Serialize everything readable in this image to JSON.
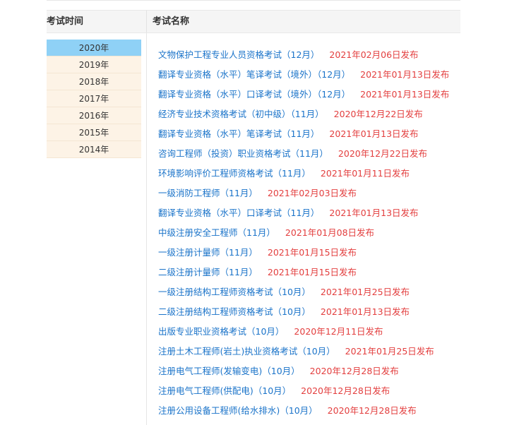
{
  "header": {
    "time_label": "考试时间",
    "name_label": "考试名称"
  },
  "years": [
    "2020年",
    "2019年",
    "2018年",
    "2017年",
    "2016年",
    "2015年",
    "2014年"
  ],
  "active_year_index": 0,
  "exams": [
    {
      "name": "文物保护工程专业人员资格考试（12月）",
      "date": "2021年02月06日发布"
    },
    {
      "name": "翻译专业资格（水平）笔译考试（境外）（12月）",
      "date": "2021年01月13日发布"
    },
    {
      "name": "翻译专业资格（水平）口译考试（境外）（12月）",
      "date": "2021年01月13日发布"
    },
    {
      "name": "经济专业技术资格考试（初中级）（11月）",
      "date": "2020年12月22日发布"
    },
    {
      "name": "翻译专业资格（水平）笔译考试（11月）",
      "date": "2021年01月13日发布"
    },
    {
      "name": "咨询工程师（投资）职业资格考试（11月）",
      "date": "2020年12月22日发布"
    },
    {
      "name": "环境影响评价工程师资格考试（11月）",
      "date": "2021年01月11日发布"
    },
    {
      "name": "一级消防工程师（11月）",
      "date": "2021年02月03日发布"
    },
    {
      "name": "翻译专业资格（水平）口译考试（11月）",
      "date": "2021年01月13日发布"
    },
    {
      "name": "中级注册安全工程师（11月）",
      "date": "2021年01月08日发布"
    },
    {
      "name": "一级注册计量师（11月）",
      "date": "2021年01月15日发布"
    },
    {
      "name": "二级注册计量师（11月）",
      "date": "2021年01月15日发布"
    },
    {
      "name": "一级注册结构工程师资格考试（10月）",
      "date": "2021年01月25日发布"
    },
    {
      "name": "二级注册结构工程师资格考试（10月）",
      "date": "2021年01月13日发布"
    },
    {
      "name": "出版专业职业资格考试（10月）",
      "date": "2020年12月11日发布"
    },
    {
      "name": "注册土木工程师(岩土)执业资格考试（10月）",
      "date": "2021年01月25日发布"
    },
    {
      "name": "注册电气工程师(发输变电)（10月）",
      "date": "2020年12月28日发布"
    },
    {
      "name": "注册电气工程师(供配电)（10月）",
      "date": "2020年12月28日发布"
    },
    {
      "name": "注册公用设备工程师(给水排水)（10月）",
      "date": "2020年12月28日发布"
    }
  ]
}
